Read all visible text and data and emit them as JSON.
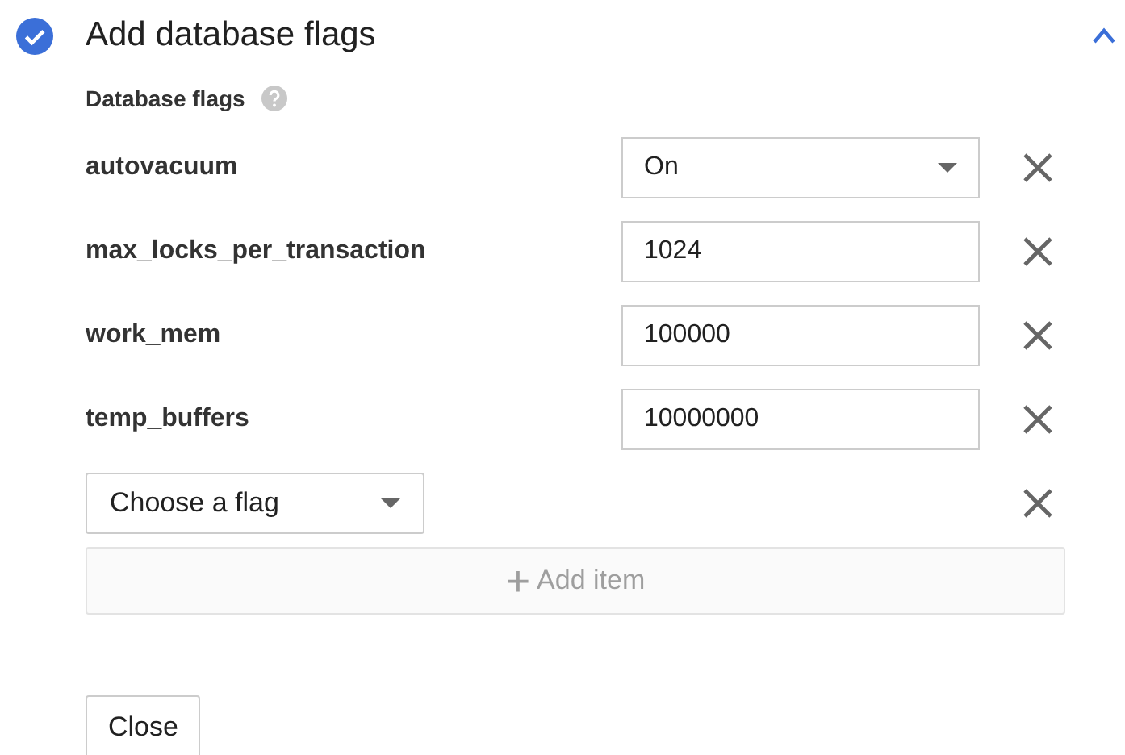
{
  "section": {
    "title": "Add database flags",
    "completed": true,
    "expanded": true
  },
  "flags_label": "Database flags",
  "flags": [
    {
      "kind": "select",
      "name": "autovacuum",
      "value": "On"
    },
    {
      "kind": "text",
      "name": "max_locks_per_transaction",
      "value": "1024"
    },
    {
      "kind": "text",
      "name": "work_mem",
      "value": "100000"
    },
    {
      "kind": "text",
      "name": "temp_buffers",
      "value": "10000000"
    }
  ],
  "new_flag": {
    "value": "Choose a flag"
  },
  "add_button": {
    "label": "Add item",
    "icon": "+",
    "disabled": true
  },
  "close_button": "Close"
}
